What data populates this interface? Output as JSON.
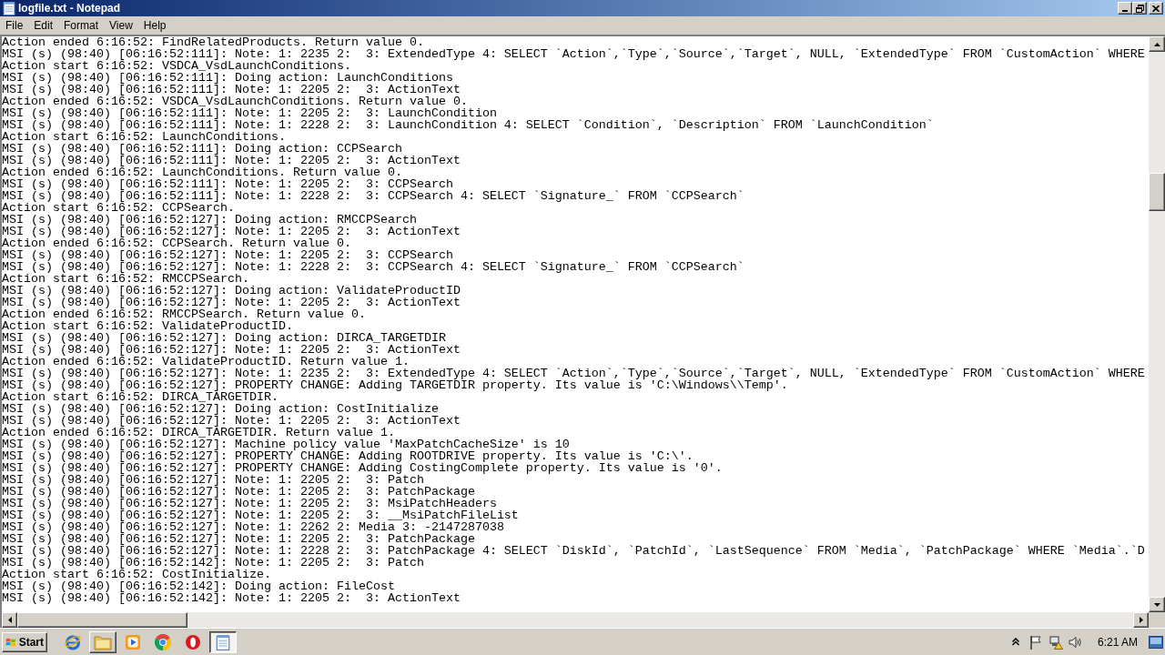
{
  "window": {
    "title": "logfile.txt - Notepad"
  },
  "menu": [
    "File",
    "Edit",
    "Format",
    "View",
    "Help"
  ],
  "lines": [
    "Action ended 6:16:52: FindRelatedProducts. Return value 0.",
    "MSI (s) (98:40) [06:16:52:111]: Note: 1: 2235 2:  3: ExtendedType 4: SELECT `Action`,`Type`,`Source`,`Target`, NULL, `ExtendedType` FROM `CustomAction` WHERE",
    "Action start 6:16:52: VSDCA_VsdLaunchConditions.",
    "MSI (s) (98:40) [06:16:52:111]: Doing action: LaunchConditions",
    "MSI (s) (98:40) [06:16:52:111]: Note: 1: 2205 2:  3: ActionText",
    "Action ended 6:16:52: VSDCA_VsdLaunchConditions. Return value 0.",
    "MSI (s) (98:40) [06:16:52:111]: Note: 1: 2205 2:  3: LaunchCondition",
    "MSI (s) (98:40) [06:16:52:111]: Note: 1: 2228 2:  3: LaunchCondition 4: SELECT `Condition`, `Description` FROM `LaunchCondition`",
    "Action start 6:16:52: LaunchConditions.",
    "MSI (s) (98:40) [06:16:52:111]: Doing action: CCPSearch",
    "MSI (s) (98:40) [06:16:52:111]: Note: 1: 2205 2:  3: ActionText",
    "Action ended 6:16:52: LaunchConditions. Return value 0.",
    "MSI (s) (98:40) [06:16:52:111]: Note: 1: 2205 2:  3: CCPSearch",
    "MSI (s) (98:40) [06:16:52:111]: Note: 1: 2228 2:  3: CCPSearch 4: SELECT `Signature_` FROM `CCPSearch`",
    "Action start 6:16:52: CCPSearch.",
    "MSI (s) (98:40) [06:16:52:127]: Doing action: RMCCPSearch",
    "MSI (s) (98:40) [06:16:52:127]: Note: 1: 2205 2:  3: ActionText",
    "Action ended 6:16:52: CCPSearch. Return value 0.",
    "MSI (s) (98:40) [06:16:52:127]: Note: 1: 2205 2:  3: CCPSearch",
    "MSI (s) (98:40) [06:16:52:127]: Note: 1: 2228 2:  3: CCPSearch 4: SELECT `Signature_` FROM `CCPSearch`",
    "Action start 6:16:52: RMCCPSearch.",
    "MSI (s) (98:40) [06:16:52:127]: Doing action: ValidateProductID",
    "MSI (s) (98:40) [06:16:52:127]: Note: 1: 2205 2:  3: ActionText",
    "Action ended 6:16:52: RMCCPSearch. Return value 0.",
    "Action start 6:16:52: ValidateProductID.",
    "MSI (s) (98:40) [06:16:52:127]: Doing action: DIRCA_TARGETDIR",
    "MSI (s) (98:40) [06:16:52:127]: Note: 1: 2205 2:  3: ActionText",
    "Action ended 6:16:52: ValidateProductID. Return value 1.",
    "MSI (s) (98:40) [06:16:52:127]: Note: 1: 2235 2:  3: ExtendedType 4: SELECT `Action`,`Type`,`Source`,`Target`, NULL, `ExtendedType` FROM `CustomAction` WHERE",
    "MSI (s) (98:40) [06:16:52:127]: PROPERTY CHANGE: Adding TARGETDIR property. Its value is 'C:\\Windows\\\\Temp'.",
    "Action start 6:16:52: DIRCA_TARGETDIR.",
    "MSI (s) (98:40) [06:16:52:127]: Doing action: CostInitialize",
    "MSI (s) (98:40) [06:16:52:127]: Note: 1: 2205 2:  3: ActionText",
    "Action ended 6:16:52: DIRCA_TARGETDIR. Return value 1.",
    "MSI (s) (98:40) [06:16:52:127]: Machine policy value 'MaxPatchCacheSize' is 10",
    "MSI (s) (98:40) [06:16:52:127]: PROPERTY CHANGE: Adding ROOTDRIVE property. Its value is 'C:\\'.",
    "MSI (s) (98:40) [06:16:52:127]: PROPERTY CHANGE: Adding CostingComplete property. Its value is '0'.",
    "MSI (s) (98:40) [06:16:52:127]: Note: 1: 2205 2:  3: Patch",
    "MSI (s) (98:40) [06:16:52:127]: Note: 1: 2205 2:  3: PatchPackage",
    "MSI (s) (98:40) [06:16:52:127]: Note: 1: 2205 2:  3: MsiPatchHeaders",
    "MSI (s) (98:40) [06:16:52:127]: Note: 1: 2205 2:  3: __MsiPatchFileList",
    "MSI (s) (98:40) [06:16:52:127]: Note: 1: 2262 2: Media 3: -2147287038",
    "MSI (s) (98:40) [06:16:52:127]: Note: 1: 2205 2:  3: PatchPackage",
    "MSI (s) (98:40) [06:16:52:127]: Note: 1: 2228 2:  3: PatchPackage 4: SELECT `DiskId`, `PatchId`, `LastSequence` FROM `Media`, `PatchPackage` WHERE `Media`.`D",
    "MSI (s) (98:40) [06:16:52:142]: Note: 1: 2205 2:  3: Patch",
    "Action start 6:16:52: CostInitialize.",
    "MSI (s) (98:40) [06:16:52:142]: Doing action: FileCost",
    "MSI (s) (98:40) [06:16:52:142]: Note: 1: 2205 2:  3: ActionText"
  ],
  "taskbar": {
    "start": "Start",
    "apps": [
      {
        "kind": "globe",
        "running": false,
        "selected": false
      },
      {
        "kind": "folder",
        "running": true,
        "selected": false
      },
      {
        "kind": "player",
        "running": false,
        "selected": false
      },
      {
        "kind": "wheel",
        "running": false,
        "selected": false
      },
      {
        "kind": "ring",
        "running": false,
        "selected": false
      },
      {
        "kind": "notepad",
        "running": true,
        "selected": true
      }
    ],
    "clock": "6:21 AM"
  }
}
